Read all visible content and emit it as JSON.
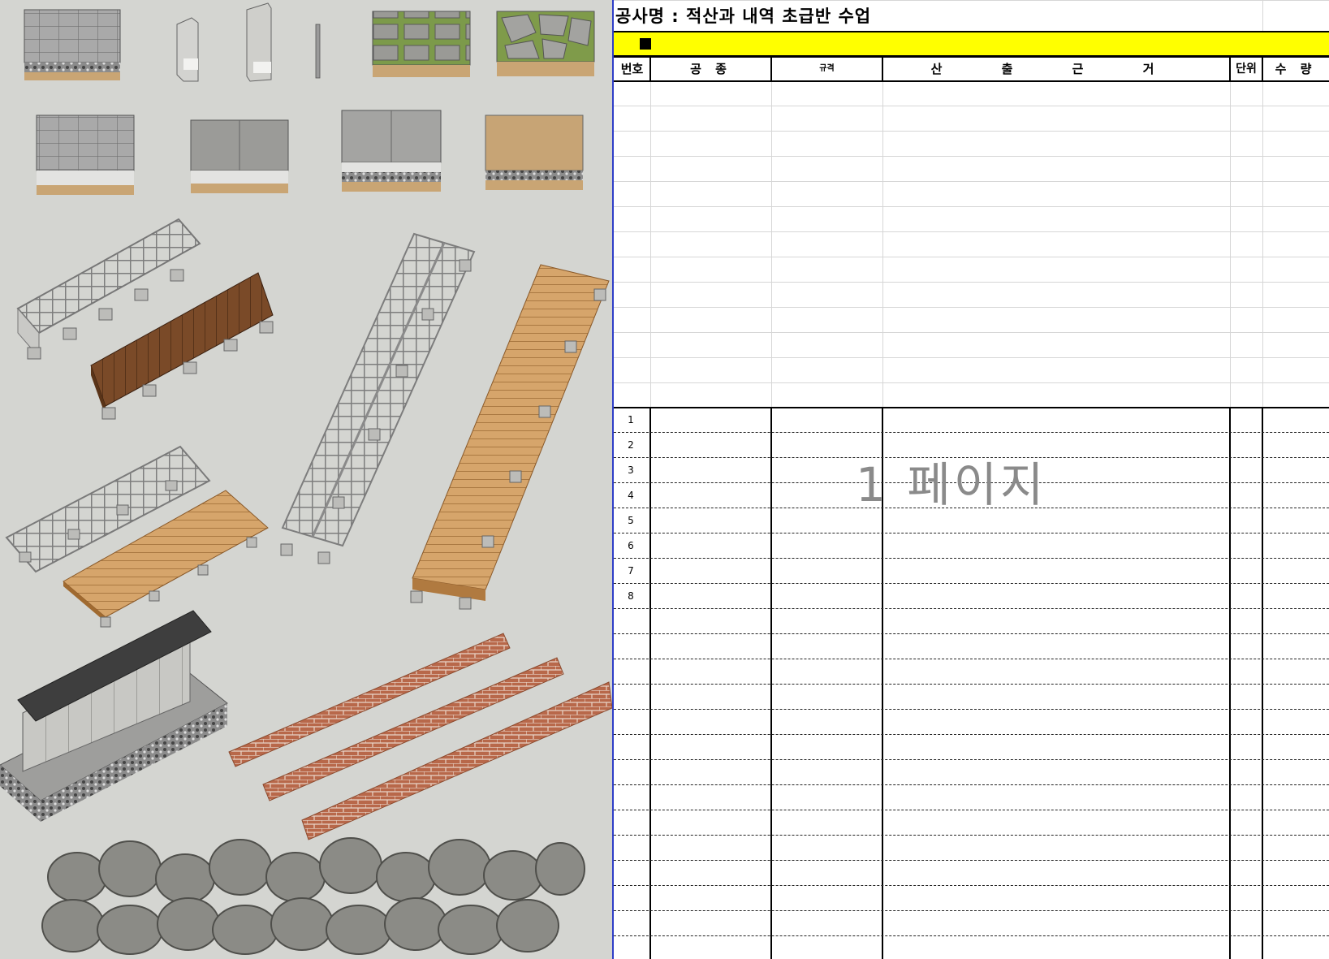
{
  "spreadsheet": {
    "title": "공사명 : 적산과 내역 초급반 수업",
    "columns": [
      "번호",
      "공 종",
      "규격",
      "산 출 근 거",
      "단위",
      "수 량"
    ],
    "row_numbers": [
      "1",
      "2",
      "3",
      "4",
      "5",
      "6",
      "7",
      "8"
    ],
    "watermark": "1 페이지",
    "colors": {
      "header_bar": "#ffff00",
      "pane_divider": "#2f3ec8",
      "viewport_background": "#d4d5d1"
    }
  },
  "model_viewport": {
    "objects": [
      "block-paving-sample",
      "curb-stone-small",
      "curb-stone-tall",
      "edge-strip",
      "grass-block-paving",
      "flagstone-paving",
      "concrete-block-paving",
      "granite-slab-paving-light",
      "granite-slab-paving-gravel",
      "clay-paving",
      "deck-frame-with-wood-cladding",
      "ramp-frame",
      "wood-ramp",
      "deck-frame-flat",
      "wood-deck-flat",
      "stone-wall-with-cap",
      "brick-wall",
      "boulder-wall"
    ]
  }
}
